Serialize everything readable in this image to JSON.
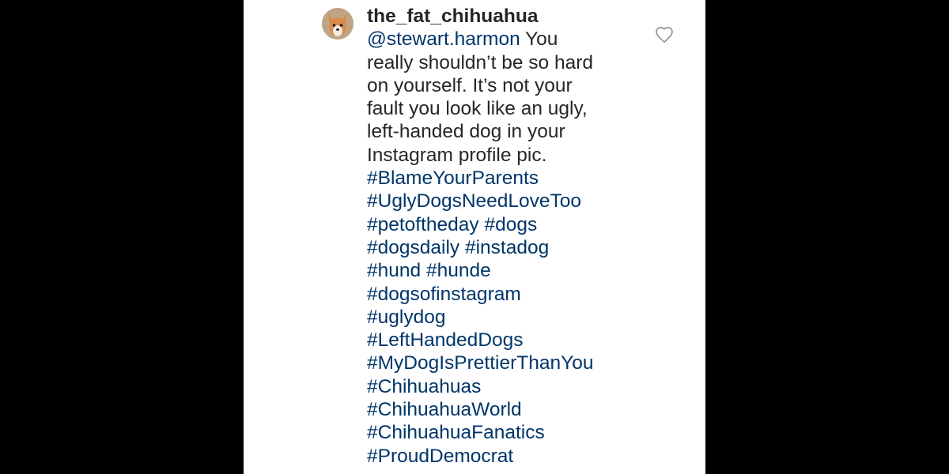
{
  "comment": {
    "username": "the_fat_chihuahua",
    "mention": "@stewart.harmon",
    "text_lines": [
      " You",
      "really shouldn’t be so hard",
      "on yourself. It’s not your",
      "fault you look like an ugly,",
      "left-handed dog in your",
      "Instagram profile pic."
    ],
    "hashtag_lines": [
      [
        "#BlameYourParents"
      ],
      [
        "#UglyDogsNeedLoveToo"
      ],
      [
        "#petoftheday",
        "#dogs"
      ],
      [
        "#dogsdaily",
        "#instadog"
      ],
      [
        "#hund",
        "#hunde"
      ],
      [
        "#dogsofinstagram"
      ],
      [
        "#uglydog"
      ],
      [
        "#LeftHandedDogs"
      ],
      [
        "#MyDogIsPrettierThanYou"
      ],
      [
        "#Chihuahuas"
      ],
      [
        "#ChihuahuaWorld"
      ],
      [
        "#ChihuahuaFanatics"
      ],
      [
        "#ProudDemocrat"
      ]
    ]
  },
  "icons": {
    "avatar": "dog-avatar",
    "like": "heart-outline-icon"
  },
  "colors": {
    "background_outer": "#000000",
    "panel": "#ffffff",
    "text": "#262626",
    "link": "#003569",
    "heart_stroke": "#8e8e8e"
  }
}
